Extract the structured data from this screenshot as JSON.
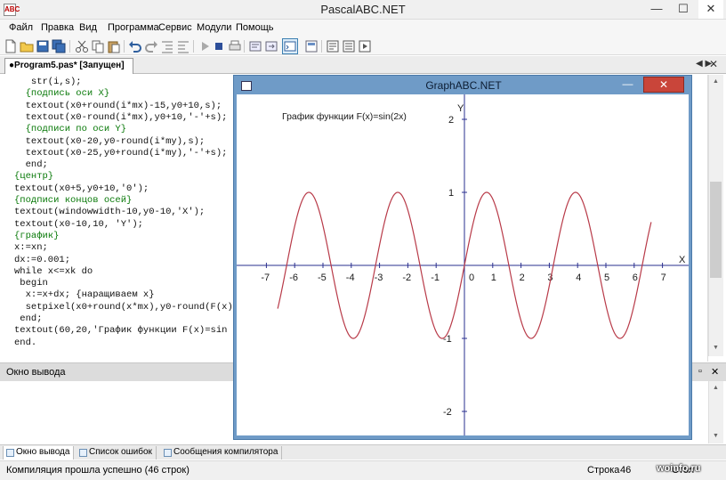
{
  "app": {
    "title": "PascalABC.NET",
    "icon_text": "ABC",
    "window_buttons": {
      "minimize": "—",
      "maximize": "☐",
      "close": "✕"
    }
  },
  "menu": [
    "Файл",
    "Правка",
    "Вид",
    "Программа",
    "Сервис",
    "Модули",
    "Помощь"
  ],
  "toolbar": [
    "new-file-icon",
    "open-icon",
    "save-icon",
    "save-all-icon",
    "cut-icon",
    "copy-icon",
    "paste-icon",
    "undo-icon",
    "redo-icon",
    "indent-icon",
    "outdent-icon",
    "run-icon",
    "stop-icon",
    "print-icon",
    "debug-icon",
    "step-icon",
    "output-window-icon",
    "form-icon",
    "compile-icon",
    "build-icon",
    "run-ext-icon"
  ],
  "editor": {
    "tab_label": "●Program5.pas* [Запущен]",
    "scroll_left": "◀ ▶",
    "close": "✕",
    "lines": [
      {
        "text": "   str(i,s);",
        "kind": "normal"
      },
      {
        "text": "  {подпись оси X}",
        "kind": "comment"
      },
      {
        "text": "  textout(x0+round(i*mx)-15,y0+10,s);",
        "kind": "normal"
      },
      {
        "text": "  textout(x0-round(i*mx),y0+10,'-'+s);",
        "kind": "normal"
      },
      {
        "text": "  {подписи по оси Y}",
        "kind": "comment"
      },
      {
        "text": "  textout(x0-20,y0-round(i*my),s);",
        "kind": "normal"
      },
      {
        "text": "  textout(x0-25,y0+round(i*my),'-'+s);",
        "kind": "normal"
      },
      {
        "text": "  end;",
        "kind": "normal"
      },
      {
        "text": "{центр}",
        "kind": "comment"
      },
      {
        "text": "textout(x0+5,y0+10,'0');",
        "kind": "normal"
      },
      {
        "text": "{подписи концов осей}",
        "kind": "comment"
      },
      {
        "text": "textout(windowwidth-10,y0-10,'X');",
        "kind": "normal"
      },
      {
        "text": "textout(x0-10,10, 'Y');",
        "kind": "normal"
      },
      {
        "text": "{график}",
        "kind": "comment"
      },
      {
        "text": "x:=xn;",
        "kind": "normal"
      },
      {
        "text": "dx:=0.001;",
        "kind": "normal"
      },
      {
        "text": "while x<=xk do",
        "kind": "normal"
      },
      {
        "text": " begin",
        "kind": "normal"
      },
      {
        "text": "  x:=x+dx; {наращиваем x}",
        "kind": "normal"
      },
      {
        "text": "  setpixel(x0+round(x*mx),y0-round(F(x)",
        "kind": "normal"
      },
      {
        "text": " end;",
        "kind": "normal"
      },
      {
        "text": "textout(60,20,'График функции F(x)=sin",
        "kind": "normal"
      },
      {
        "text": "end.",
        "kind": "normal"
      }
    ]
  },
  "output": {
    "title": "Окно вывода",
    "pin": "▫",
    "close": "✕"
  },
  "bottom_tabs": [
    "Окно вывода",
    "Список ошибок",
    "Сообщения компилятора"
  ],
  "status": {
    "message": "Компиляция прошла успешно (46 строк)",
    "line_label": "Строка",
    "line_value": "46",
    "col_label": "Стол"
  },
  "watermark": "woinfo.ru",
  "graph_window": {
    "title": "GraphABC.NET",
    "minimize": "—",
    "close": "✕"
  },
  "chart_data": {
    "type": "line",
    "function": "sin(2x)",
    "title": "График функции F(x)=sin(2x)",
    "xlabel": "X",
    "ylabel": "Y",
    "origin_label": "0",
    "xlim": [
      -7,
      7
    ],
    "ylim": [
      -2,
      2
    ],
    "x_domain": [
      -6.6,
      6.6
    ],
    "x_ticks": [
      -7,
      -6,
      -5,
      -4,
      -3,
      -2,
      -1,
      1,
      2,
      3,
      4,
      5,
      6,
      7
    ],
    "x_tick_labels": [
      "-7",
      "-6",
      "-5",
      "-4",
      "-3",
      "-2",
      "-1",
      "1",
      "2",
      "3",
      "4",
      "5",
      "6",
      "7"
    ],
    "y_ticks": [
      2,
      1,
      -1,
      -2
    ],
    "y_tick_labels": [
      "2",
      "1",
      "-1",
      "-2"
    ],
    "colors": {
      "curve": "#b83a48",
      "axes": "#2a2f8f",
      "text": "#1a1a1a"
    }
  }
}
